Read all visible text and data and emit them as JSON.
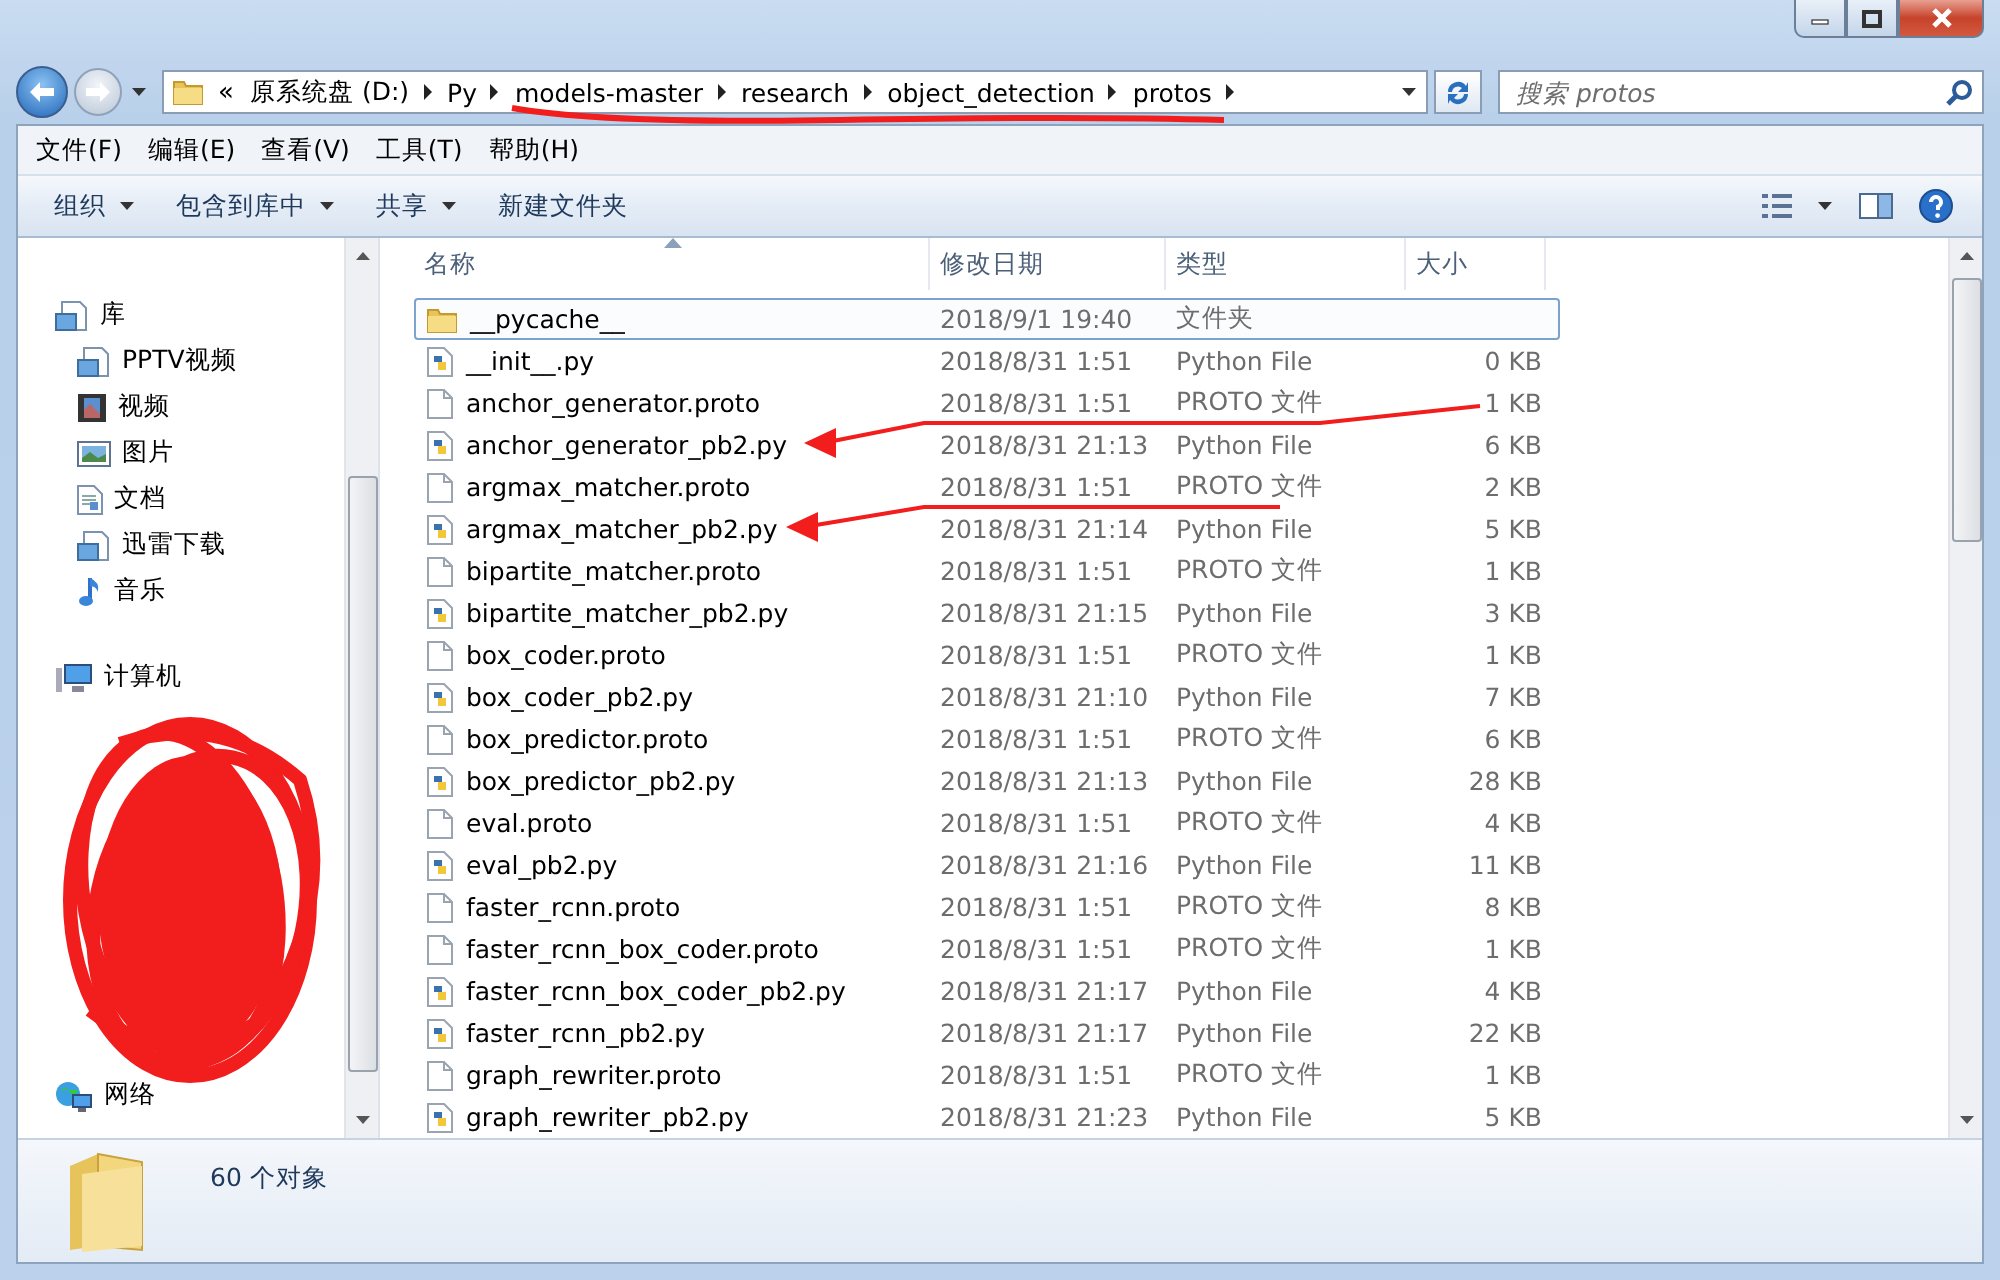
{
  "address_bar": {
    "overflow": "«",
    "crumbs": [
      "原系统盘 (D:)",
      "Py",
      "models-master",
      "research",
      "object_detection",
      "protos"
    ]
  },
  "search": {
    "placeholder": "搜索 protos"
  },
  "menu": [
    "文件(F)",
    "编辑(E)",
    "查看(V)",
    "工具(T)",
    "帮助(H)"
  ],
  "toolbar": [
    {
      "label": "组织",
      "dropdown": true
    },
    {
      "label": "包含到库中",
      "dropdown": true
    },
    {
      "label": "共享",
      "dropdown": true
    },
    {
      "label": "新建文件夹",
      "dropdown": false
    }
  ],
  "sidebar": [
    {
      "label": "库",
      "kind": "library",
      "children": [
        {
          "label": "PPTV视频",
          "kind": "library"
        },
        {
          "label": "视频",
          "kind": "video"
        },
        {
          "label": "图片",
          "kind": "pictures"
        },
        {
          "label": "文档",
          "kind": "documents"
        },
        {
          "label": "迅雷下载",
          "kind": "library"
        },
        {
          "label": "音乐",
          "kind": "music"
        }
      ]
    },
    {
      "label": "计算机",
      "kind": "computer"
    },
    {
      "label": "网络",
      "kind": "network"
    }
  ],
  "columns": [
    {
      "label": "名称",
      "sorted": true
    },
    {
      "label": "修改日期",
      "sorted": false
    },
    {
      "label": "类型",
      "sorted": false
    },
    {
      "label": "大小",
      "sorted": false
    }
  ],
  "files": [
    {
      "name": "__pycache__",
      "date": "2018/9/1 19:40",
      "type": "文件夹",
      "kind": "folder",
      "selected": true
    },
    {
      "name": "__init__.py",
      "date": "2018/8/31 1:51",
      "type": "Python File",
      "size": "0 KB",
      "kind": "python",
      "selected": false
    },
    {
      "name": "anchor_generator.proto",
      "date": "2018/8/31 1:51",
      "type": "PROTO 文件",
      "size": "1 KB",
      "kind": "proto",
      "selected": false
    },
    {
      "name": "anchor_generator_pb2.py",
      "date": "2018/8/31 21:13",
      "type": "Python File",
      "size": "6 KB",
      "kind": "python",
      "selected": false
    },
    {
      "name": "argmax_matcher.proto",
      "date": "2018/8/31 1:51",
      "type": "PROTO 文件",
      "size": "2 KB",
      "kind": "proto",
      "selected": false
    },
    {
      "name": "argmax_matcher_pb2.py",
      "date": "2018/8/31 21:14",
      "type": "Python File",
      "size": "5 KB",
      "kind": "python",
      "selected": false
    },
    {
      "name": "bipartite_matcher.proto",
      "date": "2018/8/31 1:51",
      "type": "PROTO 文件",
      "size": "1 KB",
      "kind": "proto",
      "selected": false
    },
    {
      "name": "bipartite_matcher_pb2.py",
      "date": "2018/8/31 21:15",
      "type": "Python File",
      "size": "3 KB",
      "kind": "python",
      "selected": false
    },
    {
      "name": "box_coder.proto",
      "date": "2018/8/31 1:51",
      "type": "PROTO 文件",
      "size": "1 KB",
      "kind": "proto",
      "selected": false
    },
    {
      "name": "box_coder_pb2.py",
      "date": "2018/8/31 21:10",
      "type": "Python File",
      "size": "7 KB",
      "kind": "python",
      "selected": false
    },
    {
      "name": "box_predictor.proto",
      "date": "2018/8/31 1:51",
      "type": "PROTO 文件",
      "size": "6 KB",
      "kind": "proto",
      "selected": false
    },
    {
      "name": "box_predictor_pb2.py",
      "date": "2018/8/31 21:13",
      "type": "Python File",
      "size": "28 KB",
      "kind": "python",
      "selected": false
    },
    {
      "name": "eval.proto",
      "date": "2018/8/31 1:51",
      "type": "PROTO 文件",
      "size": "4 KB",
      "kind": "proto",
      "selected": false
    },
    {
      "name": "eval_pb2.py",
      "date": "2018/8/31 21:16",
      "type": "Python File",
      "size": "11 KB",
      "kind": "python",
      "selected": false
    },
    {
      "name": "faster_rcnn.proto",
      "date": "2018/8/31 1:51",
      "type": "PROTO 文件",
      "size": "8 KB",
      "kind": "proto",
      "selected": false
    },
    {
      "name": "faster_rcnn_box_coder.proto",
      "date": "2018/8/31 1:51",
      "type": "PROTO 文件",
      "size": "1 KB",
      "kind": "proto",
      "selected": false
    },
    {
      "name": "faster_rcnn_box_coder_pb2.py",
      "date": "2018/8/31 21:17",
      "type": "Python File",
      "size": "4 KB",
      "kind": "python",
      "selected": false
    },
    {
      "name": "faster_rcnn_pb2.py",
      "date": "2018/8/31 21:17",
      "type": "Python File",
      "size": "22 KB",
      "kind": "python",
      "selected": false
    },
    {
      "name": "graph_rewriter.proto",
      "date": "2018/8/31 1:51",
      "type": "PROTO 文件",
      "size": "1 KB",
      "kind": "proto",
      "selected": false
    },
    {
      "name": "graph_rewriter_pb2.py",
      "date": "2018/8/31 21:23",
      "type": "Python File",
      "size": "5 KB",
      "kind": "python",
      "selected": false
    }
  ],
  "status": "60 个对象"
}
